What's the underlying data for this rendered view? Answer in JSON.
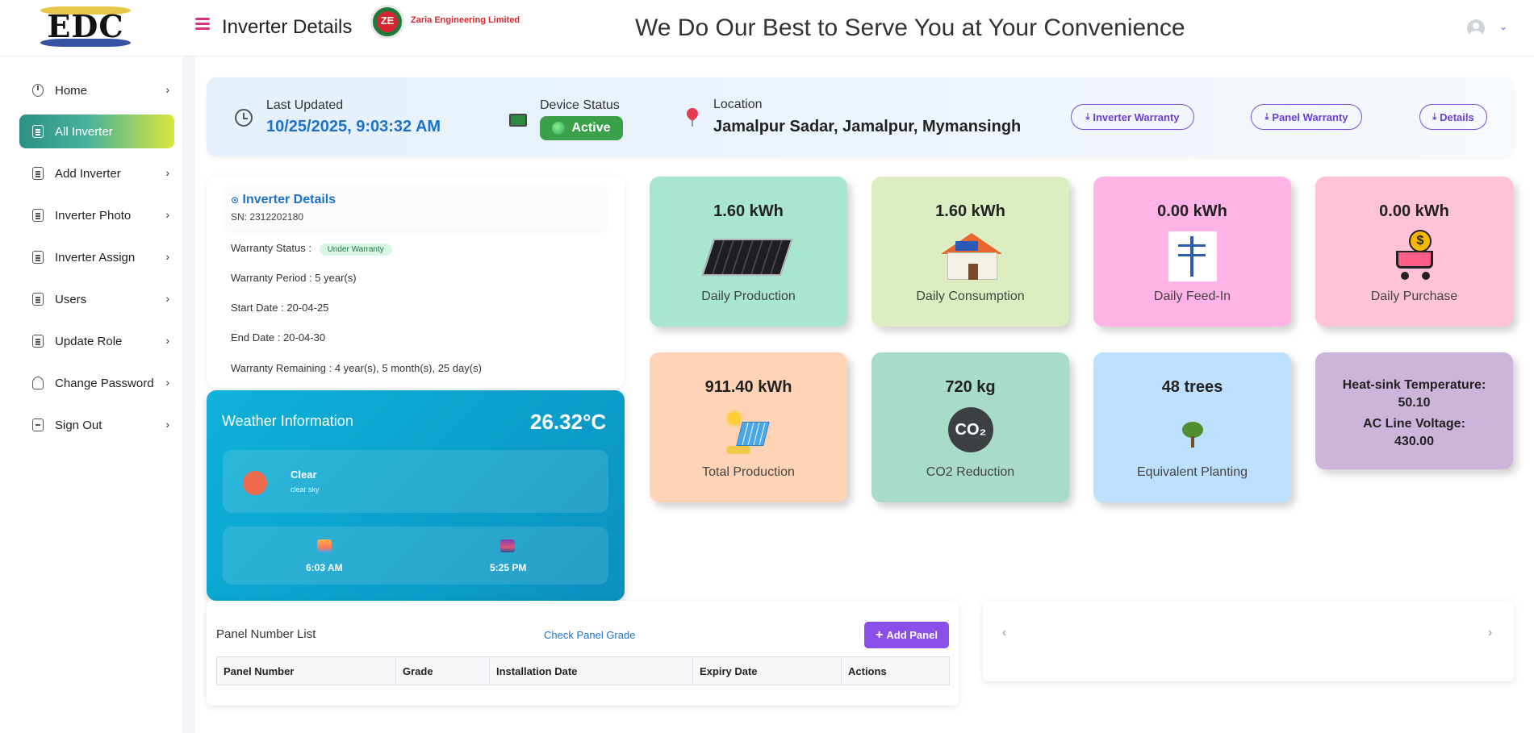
{
  "header": {
    "logo_text": "EDC",
    "page_title": "Inverter Details",
    "partner_logo_text": "ZE",
    "partner_name": "Zaria Engineering Limited",
    "tagline": "We Do Our Best to Serve You at Your Convenience"
  },
  "sidebar": {
    "items": [
      {
        "label": "Home",
        "icon": "home-icon"
      },
      {
        "label": "All Inverter",
        "icon": "document-icon",
        "active": true
      },
      {
        "label": "Add Inverter",
        "icon": "document-icon"
      },
      {
        "label": "Inverter Photo",
        "icon": "document-icon"
      },
      {
        "label": "Inverter Assign",
        "icon": "document-icon"
      },
      {
        "label": "Users",
        "icon": "document-icon"
      },
      {
        "label": "Update Role",
        "icon": "document-icon"
      },
      {
        "label": "Change Password",
        "icon": "user-icon"
      },
      {
        "label": "Sign Out",
        "icon": "sign-out-icon"
      }
    ],
    "chevron": "›"
  },
  "status": {
    "last_updated_label": "Last Updated",
    "last_updated_value": "10/25/2025, 9:03:32 AM",
    "device_status_label": "Device Status",
    "device_status_value": "Active",
    "location_label": "Location",
    "location_value": "Jamalpur Sadar, Jamalpur, Mymansingh",
    "buttons": {
      "inverter_warranty": "Inverter Warranty",
      "panel_warranty": "Panel Warranty",
      "details": "Details"
    },
    "download_glyph": "⤓",
    "active_color": "#3aa14a"
  },
  "inverter": {
    "title_glyph": "⊙",
    "title": "Inverter Details",
    "sn": "SN: 2312202180",
    "warranty_status_label": "Warranty Status :",
    "warranty_status_value": "Under Warranty",
    "warranty_period": "Warranty Period : 5 year(s)",
    "start_date": "Start Date : 20-04-25",
    "end_date": "End Date : 20-04-30",
    "warranty_remaining": "Warranty Remaining : 4 year(s), 5 month(s), 25 day(s)"
  },
  "weather": {
    "title": "Weather Information",
    "temperature": "26.32°C",
    "condition": "Clear",
    "description": "clear sky",
    "sunrise": "6:03 AM",
    "sunset": "5:25 PM"
  },
  "stats": {
    "daily_production": {
      "value": "1.60 kWh",
      "label": "Daily Production",
      "color": "#a8e6cf"
    },
    "daily_consumption": {
      "value": "1.60 kWh",
      "label": "Daily Consumption",
      "color": "#dcedc1"
    },
    "daily_feed_in": {
      "value": "0.00 kWh",
      "label": "Daily Feed-In",
      "color": "#ffb3e6"
    },
    "daily_purchase": {
      "value": "0.00 kWh",
      "label": "Daily Purchase",
      "color": "#ffc3d9"
    },
    "total_production": {
      "value": "911.40 kWh",
      "label": "Total Production",
      "color": "#ffd3b6"
    },
    "co2_reduction": {
      "value": "720 kg",
      "label": "CO2 Reduction",
      "color": "#a8dcc9",
      "icon_text": "CO₂"
    },
    "equivalent_planting": {
      "value": "48 trees",
      "label": "Equivalent Planting",
      "color": "#bde0fe"
    },
    "heatsink": {
      "label1": "Heat-sink Temperature:",
      "value1": "50.10",
      "label2": "AC Line Voltage:",
      "value2": "430.00",
      "color": "#cdb4db"
    },
    "purchase_coin": "$"
  },
  "panel_list": {
    "title": "Panel Number List",
    "check_link": "Check Panel Grade",
    "add_button": "Add Panel",
    "add_glyph": "+",
    "columns": [
      "Panel Number",
      "Grade",
      "Installation Date",
      "Expiry Date",
      "Actions"
    ]
  },
  "slider": {
    "prev": "‹",
    "next": "›"
  },
  "user": {
    "caret": "⌄"
  }
}
